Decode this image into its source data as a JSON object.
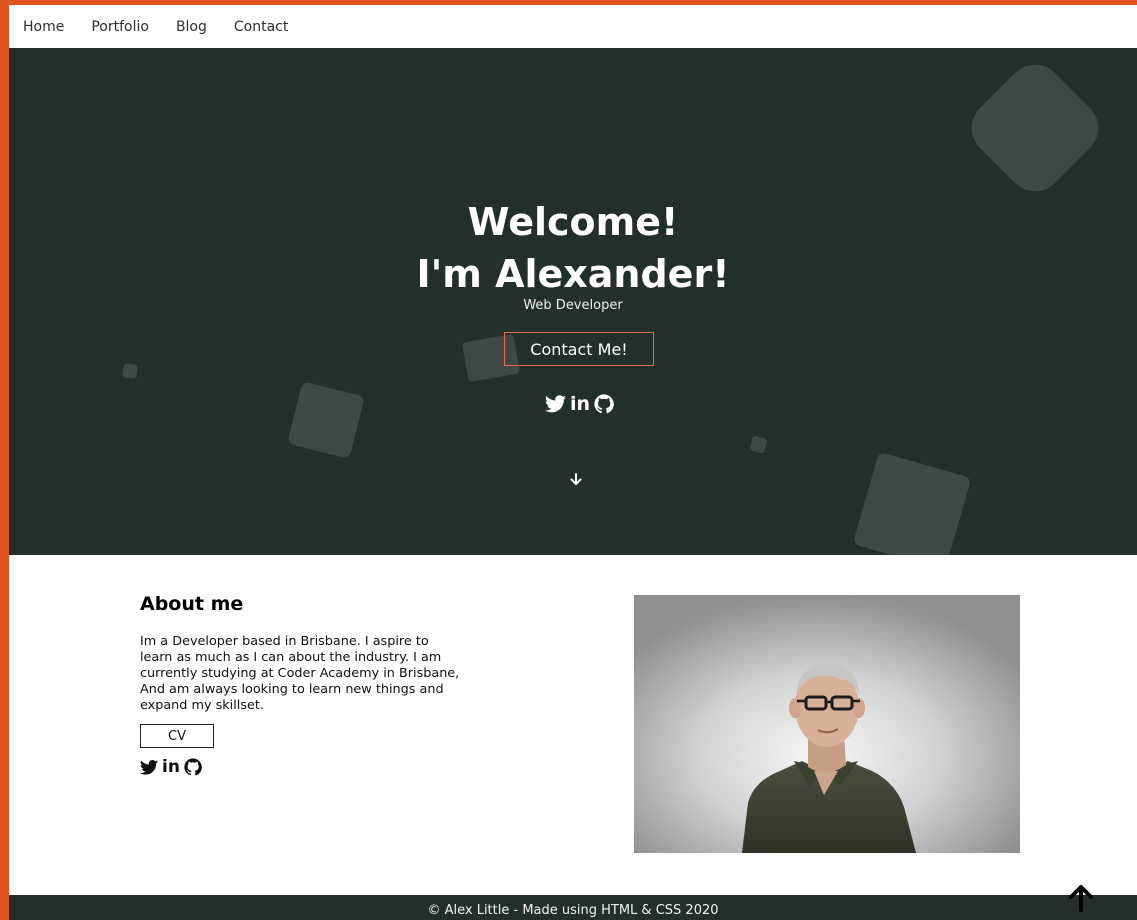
{
  "nav": {
    "items": [
      {
        "label": "Home"
      },
      {
        "label": "Portfolio"
      },
      {
        "label": "Blog"
      },
      {
        "label": "Contact"
      }
    ]
  },
  "hero": {
    "title_line1": "Welcome!",
    "title_line2": "I'm Alexander!",
    "subtitle": "Web Developer",
    "contact_button": "Contact Me!",
    "social_icons": [
      "twitter-icon",
      "linkedin-icon",
      "github-icon"
    ],
    "linkedin_text": "in"
  },
  "about": {
    "title": "About me",
    "text": "Im a Developer based in Brisbane. I aspire to learn as much as I can about the industry. I am currently studying at Coder Academy in Brisbane, And am always looking to learn new things and expand my skillset.",
    "cv_button": "CV",
    "linkedin_text": "in"
  },
  "footer": {
    "text": "© Alex Little - Made using HTML & CSS 2020"
  },
  "colors": {
    "accent": "#e0531e",
    "hero_bg": "#233029",
    "shape": "#3d4942",
    "button_border": "#e8694a"
  }
}
